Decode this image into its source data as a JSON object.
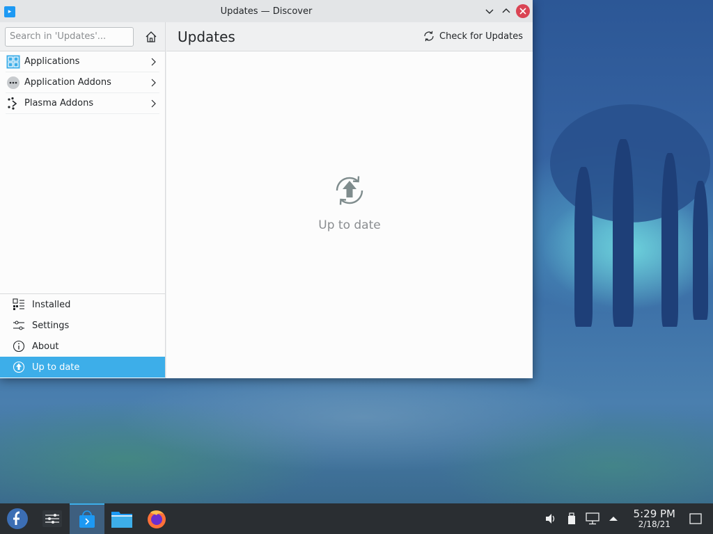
{
  "window": {
    "title": "Updates — Discover"
  },
  "sidebar": {
    "search_placeholder": "Search in 'Updates'...",
    "categories": [
      {
        "label": "Applications",
        "icon": "applications-grid-icon"
      },
      {
        "label": "Application Addons",
        "icon": "addons-dots-icon"
      },
      {
        "label": "Plasma Addons",
        "icon": "plasma-addons-icon"
      }
    ],
    "nav": [
      {
        "label": "Installed",
        "icon": "installed-list-icon"
      },
      {
        "label": "Settings",
        "icon": "settings-sliders-icon"
      },
      {
        "label": "About",
        "icon": "info-icon"
      },
      {
        "label": "Up to date",
        "icon": "update-status-icon",
        "active": true
      }
    ]
  },
  "main": {
    "title": "Updates",
    "check_label": "Check for Updates",
    "status_text": "Up to date"
  },
  "taskbar": {
    "apps": [
      "fedora-launcher-icon",
      "system-settings-icon",
      "discover-icon",
      "file-manager-icon",
      "firefox-icon"
    ],
    "clock_time": "5:29 PM",
    "clock_date": "2/18/21"
  },
  "colors": {
    "accent": "#3daee9",
    "close": "#da4453",
    "taskbar": "#2a2e32"
  }
}
